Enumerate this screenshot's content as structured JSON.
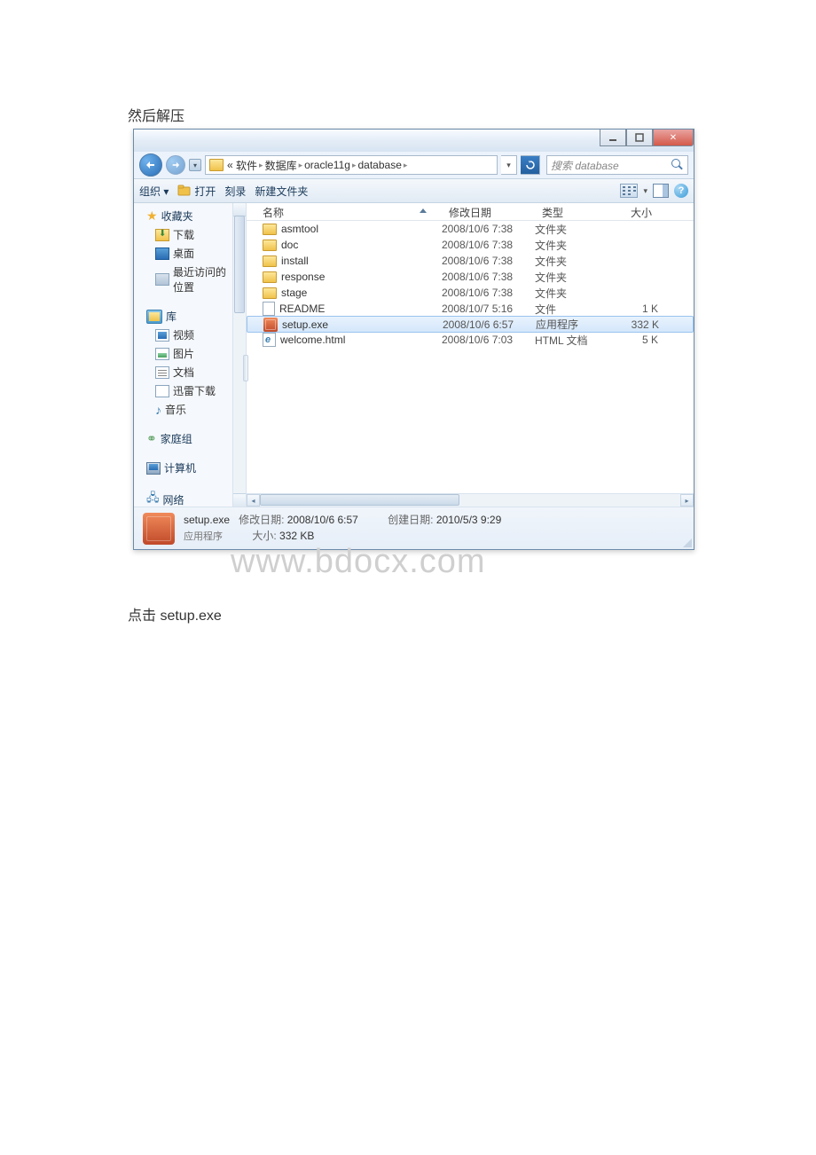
{
  "doc": {
    "text_above": "然后解压",
    "text_below": "点击 setup.exe"
  },
  "window": {
    "controls": {
      "min": "minimize",
      "max": "maximize",
      "close": "close"
    },
    "breadcrumb": {
      "segments": [
        "«",
        "软件",
        "▸",
        "数据库",
        "▸",
        "oracle11g",
        "▸",
        "database",
        "▸"
      ]
    },
    "search": {
      "placeholder": "搜索 database"
    },
    "toolbar": {
      "organize": "组织 ▾",
      "open": "打开",
      "burn": "刻录",
      "newfolder": "新建文件夹"
    },
    "sidebar": {
      "fav": "收藏夹",
      "fav_items": [
        "下载",
        "桌面",
        "最近访问的位置"
      ],
      "lib": "库",
      "lib_items": [
        "视频",
        "图片",
        "文档",
        "迅雷下载",
        "音乐"
      ],
      "homegroup": "家庭组",
      "computer": "计算机",
      "network": "网络"
    },
    "columns": {
      "name": "名称",
      "date": "修改日期",
      "type": "类型",
      "size": "大小"
    },
    "files": [
      {
        "icon": "folder",
        "name": "asmtool",
        "date": "2008/10/6 7:38",
        "type": "文件夹",
        "size": ""
      },
      {
        "icon": "folder",
        "name": "doc",
        "date": "2008/10/6 7:38",
        "type": "文件夹",
        "size": ""
      },
      {
        "icon": "folder",
        "name": "install",
        "date": "2008/10/6 7:38",
        "type": "文件夹",
        "size": ""
      },
      {
        "icon": "folder",
        "name": "response",
        "date": "2008/10/6 7:38",
        "type": "文件夹",
        "size": ""
      },
      {
        "icon": "folder",
        "name": "stage",
        "date": "2008/10/6 7:38",
        "type": "文件夹",
        "size": ""
      },
      {
        "icon": "file",
        "name": "README",
        "date": "2008/10/7 5:16",
        "type": "文件",
        "size": "1 K"
      },
      {
        "icon": "exe",
        "name": "setup.exe",
        "date": "2008/10/6 6:57",
        "type": "应用程序",
        "size": "332 K",
        "selected": true
      },
      {
        "icon": "html",
        "name": "welcome.html",
        "date": "2008/10/6 7:03",
        "type": "HTML 文档",
        "size": "5 K"
      }
    ],
    "details": {
      "name": "setup.exe",
      "type": "应用程序",
      "mod_label": "修改日期:",
      "mod_value": "2008/10/6 6:57",
      "create_label": "创建日期:",
      "create_value": "2010/5/3 9:29",
      "size_label": "大小:",
      "size_value": "332 KB"
    }
  },
  "watermark": "www.bdocx.com"
}
